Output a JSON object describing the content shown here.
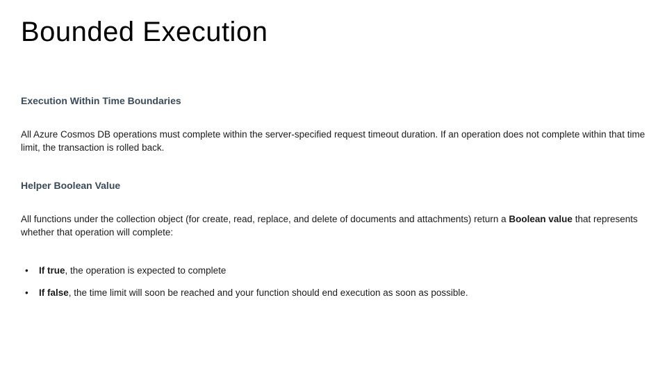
{
  "title": "Bounded Execution",
  "sections": [
    {
      "heading": "Execution Within Time Boundaries",
      "paragraph": "All Azure Cosmos DB operations must complete within the server-specified request timeout duration. If an operation does not complete within that time limit, the transaction is rolled back."
    },
    {
      "heading": "Helper Boolean Value",
      "paragraph_prefix": "All functions under the collection object (for create, read, replace, and delete of documents and attachments) return a ",
      "paragraph_bold": "Boolean value",
      "paragraph_suffix": " that represents whether that operation will complete:",
      "bullets": [
        {
          "bold": "If true",
          "rest": ", the operation is expected to complete"
        },
        {
          "bold": "If false",
          "rest": ", the time limit will soon be reached and your function should end execution as soon as possible."
        }
      ]
    }
  ]
}
